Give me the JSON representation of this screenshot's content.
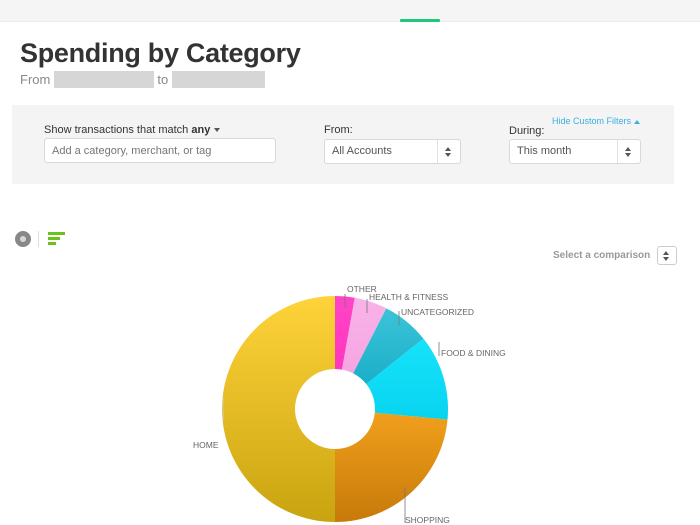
{
  "page": {
    "title": "Spending by Category",
    "from_label": "From",
    "to_label": "to"
  },
  "filters": {
    "match_label": "Show transactions that match",
    "match_value": "any",
    "search_placeholder": "Add a category, merchant, or tag",
    "search_value": "",
    "from_label": "From:",
    "from_value": "All Accounts",
    "during_label": "During:",
    "during_value": "This month",
    "hide_filters_link": "Hide Custom Filters"
  },
  "view_toggle": {
    "donut_icon": "donut-chart-icon",
    "bars_icon": "bar-chart-icon",
    "active": "donut"
  },
  "comparison": {
    "label": "Select a comparison"
  },
  "colors": {
    "accent_green": "#1ec97e",
    "link_blue": "#3ab0e2",
    "bar_icon_green": "#6cc11a"
  },
  "chart_data": {
    "type": "pie",
    "title": "Spending by Category",
    "donut": true,
    "start_angle": "top, clockwise",
    "unit": "percent of total (estimated)",
    "slices": [
      {
        "label": "OTHER",
        "value": 2.8,
        "color": "#ff44c8",
        "color2": "#ff2fb8"
      },
      {
        "label": "HEALTH & FITNESS",
        "value": 4.7,
        "color": "#f8b3e8",
        "color2": "#f59fe0"
      },
      {
        "label": "UNCATEGORIZED",
        "value": 6.8,
        "color": "#3cc4d8",
        "color2": "#0fa8c2"
      },
      {
        "label": "FOOD & DINING",
        "value": 12.2,
        "color": "#16e2fb",
        "color2": "#08d4f0"
      },
      {
        "label": "SHOPPING",
        "value": 23.5,
        "color": "#f2a11c",
        "color2": "#c77a0a"
      },
      {
        "label": "HOME",
        "value": 50.0,
        "color": "#ffd33a",
        "color2": "#c9a410"
      }
    ]
  }
}
